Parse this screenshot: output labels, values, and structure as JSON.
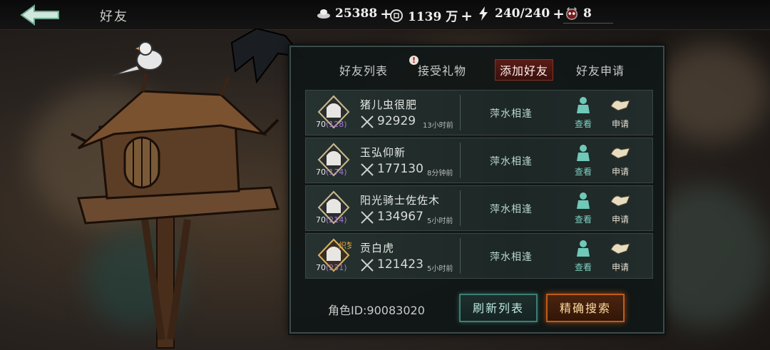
{
  "header": {
    "title": "好友",
    "back_icon": "back-arrow-icon",
    "silver": "25388",
    "coins": "1139 万",
    "energy": "240/240",
    "masks": "8"
  },
  "tabs": [
    {
      "label": "好友列表"
    },
    {
      "label": "接受礼物",
      "alert": "!"
    },
    {
      "label": "添加好友",
      "active": true
    },
    {
      "label": "好友申请"
    }
  ],
  "players": [
    {
      "name": "猪儿虫很肥",
      "level": "70",
      "sub_level": "(128)",
      "power": "92929",
      "time": "13小时前",
      "status": "萍水相逢"
    },
    {
      "name": "玉弘仰新",
      "level": "70",
      "sub_level": "(174)",
      "power": "177130",
      "time": "8分钟前",
      "status": "萍水相逢"
    },
    {
      "name": "阳光骑士佐佐木",
      "level": "70",
      "sub_level": "(214)",
      "power": "134967",
      "time": "5小时前",
      "status": "萍水相逢"
    },
    {
      "name": "贡白虎",
      "level": "70",
      "sub_level": "(231)",
      "power": "121423",
      "time": "5小时前",
      "status": "萍水相逢",
      "badge": "织梦"
    }
  ],
  "actions": {
    "view": "查看",
    "apply": "申请"
  },
  "footer": {
    "role_id": "角色ID:90083020",
    "refresh_label": "刷新列表",
    "search_label": "精确搜索"
  },
  "colors": {
    "active_tab": "#5a1c16",
    "refresh_border": "#3e7e74",
    "search_border": "#c25a1a",
    "sub_level": "#a875d8"
  }
}
